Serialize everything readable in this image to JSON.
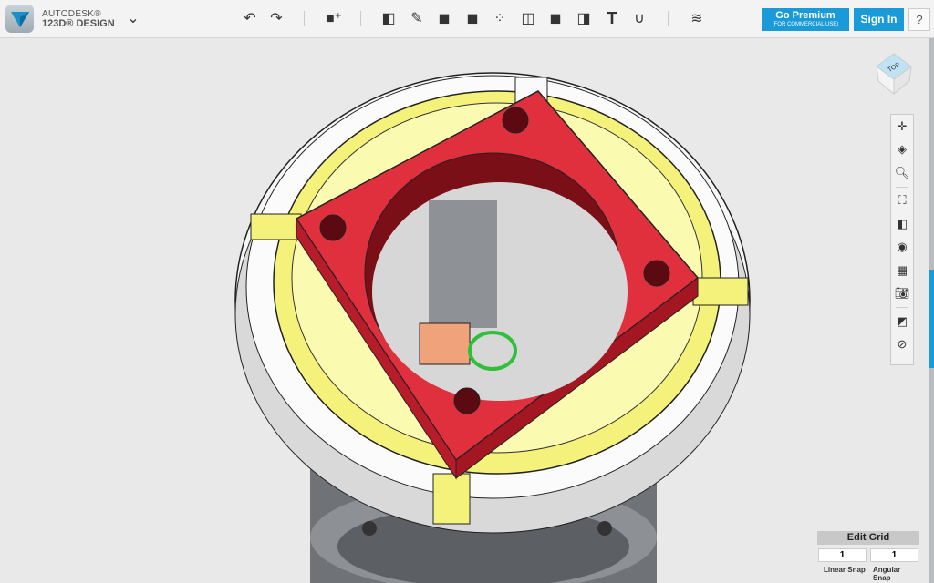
{
  "app": {
    "brand_top": "AUTODESK®",
    "brand_bottom": "123D® DESIGN"
  },
  "toolbar": {
    "items": [
      "undo-icon",
      "redo-icon",
      "primitives-icon",
      "sketch-icon",
      "construct-icon",
      "modify-icon",
      "pattern-icon",
      "grouping-icon",
      "combine-icon",
      "measure-icon",
      "text-icon",
      "snap-icon",
      "material-icon"
    ]
  },
  "header": {
    "premium_label": "Go Premium",
    "premium_sub": "(FOR COMMERCIAL USE)",
    "signin_label": "Sign In",
    "help_label": "?"
  },
  "viewcube": {
    "face": "TOP"
  },
  "grid": {
    "title": "Edit Grid",
    "linear_value": "1",
    "angular_value": "1",
    "linear_label": "Linear Snap",
    "angular_label": "Angular Snap"
  },
  "colors": {
    "accent": "#1a9bd7",
    "red_part": "#e0303e",
    "yellow_part": "#f4f27a"
  }
}
